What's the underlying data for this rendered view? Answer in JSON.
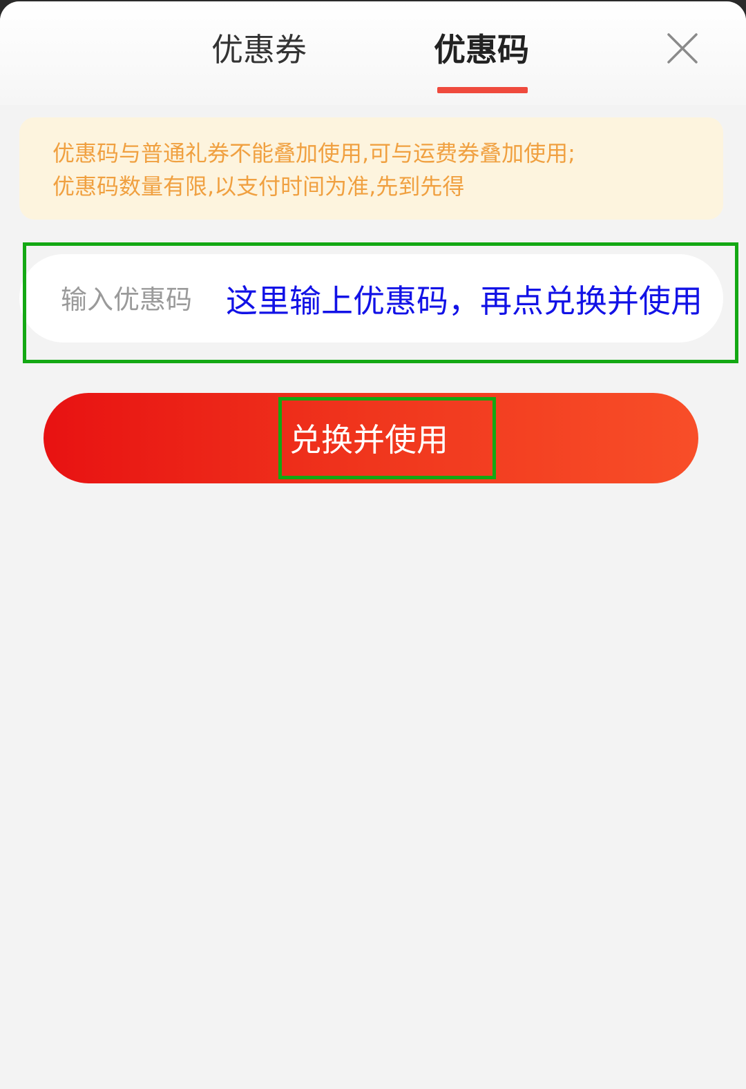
{
  "tabs": [
    {
      "label": "优惠券",
      "active": false
    },
    {
      "label": "优惠码",
      "active": true
    }
  ],
  "notice": {
    "line1": "优惠码与普通礼券不能叠加使用,可与运费券叠加使用;",
    "line2": "优惠码数量有限,以支付时间为准,先到先得"
  },
  "code_input": {
    "label": "输入优惠码",
    "value": ""
  },
  "annotation_text": "这里输上优惠码，再点兑换并使用",
  "redeem_button": {
    "label": "兑换并使用"
  },
  "icons": {
    "close": "close-icon"
  },
  "colors": {
    "accent": "#ef4a3d",
    "notice_text": "#f0a040",
    "notice_bg": "#fdf4de",
    "annotation_text": "#1212e6",
    "annotation_box": "#13a813",
    "button_start": "#e81212",
    "button_end": "#f84e28"
  }
}
